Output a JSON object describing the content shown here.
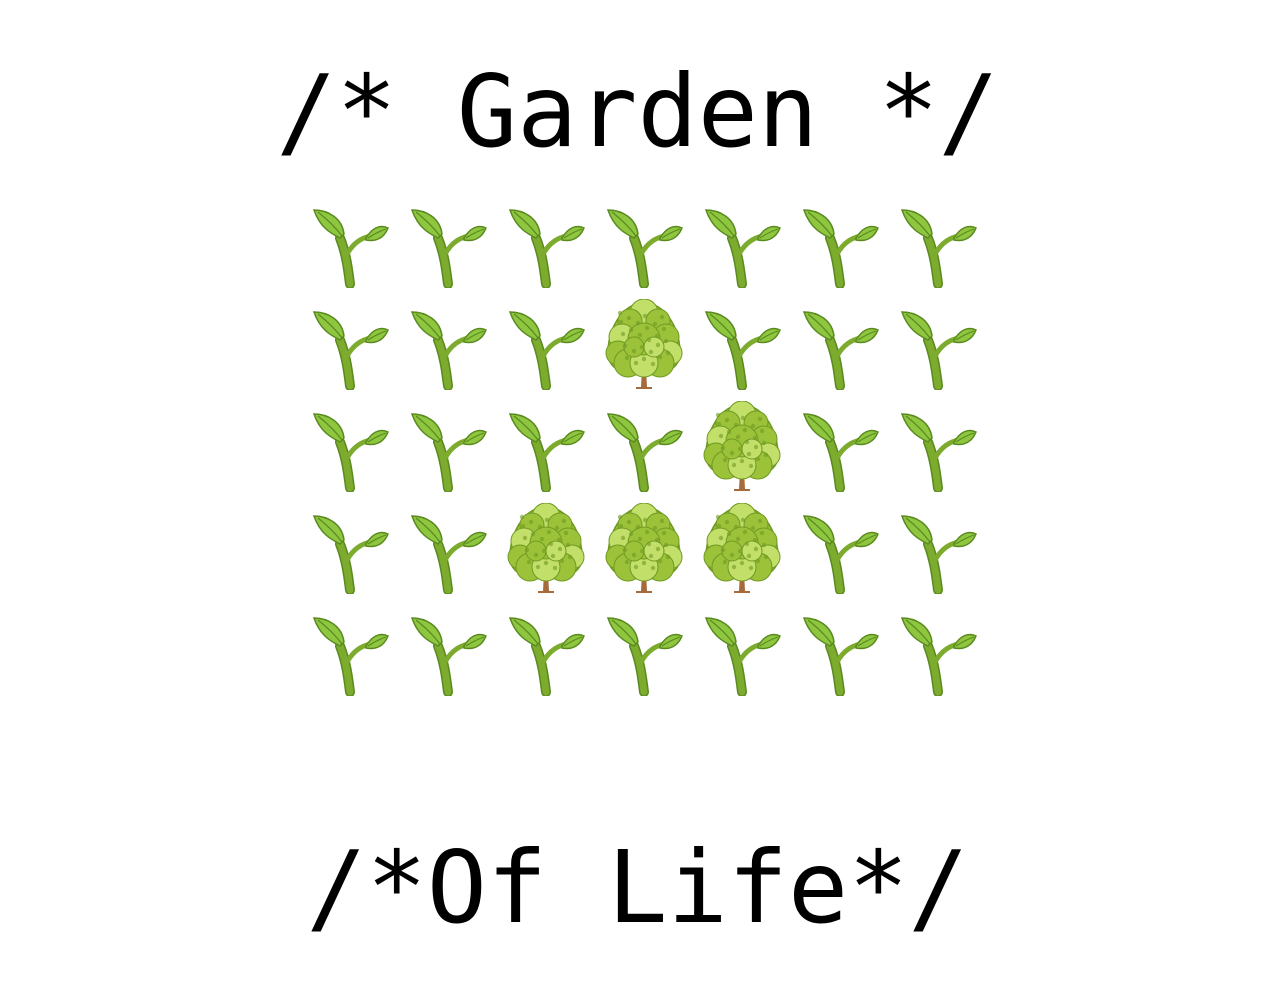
{
  "header": {
    "title": "/* Garden */"
  },
  "footer": {
    "title": "/*Of Life*/"
  },
  "garden": {
    "legend": {
      "0": "seedling-icon",
      "1": "tree-icon"
    },
    "rows": [
      [
        0,
        0,
        0,
        0,
        0,
        0,
        0
      ],
      [
        0,
        0,
        0,
        1,
        0,
        0,
        0
      ],
      [
        0,
        0,
        0,
        0,
        1,
        0,
        0
      ],
      [
        0,
        0,
        1,
        1,
        1,
        0,
        0
      ],
      [
        0,
        0,
        0,
        0,
        0,
        0,
        0
      ]
    ]
  },
  "colors": {
    "seedling_stem": "#7cab2e",
    "seedling_leaf": "#8ec63f",
    "seedling_dark": "#5a8a1f",
    "tree_canopy": "#9cc23a",
    "tree_canopy_dark": "#6f9a22",
    "tree_canopy_light": "#c2df6a",
    "tree_trunk": "#a66a3b"
  }
}
